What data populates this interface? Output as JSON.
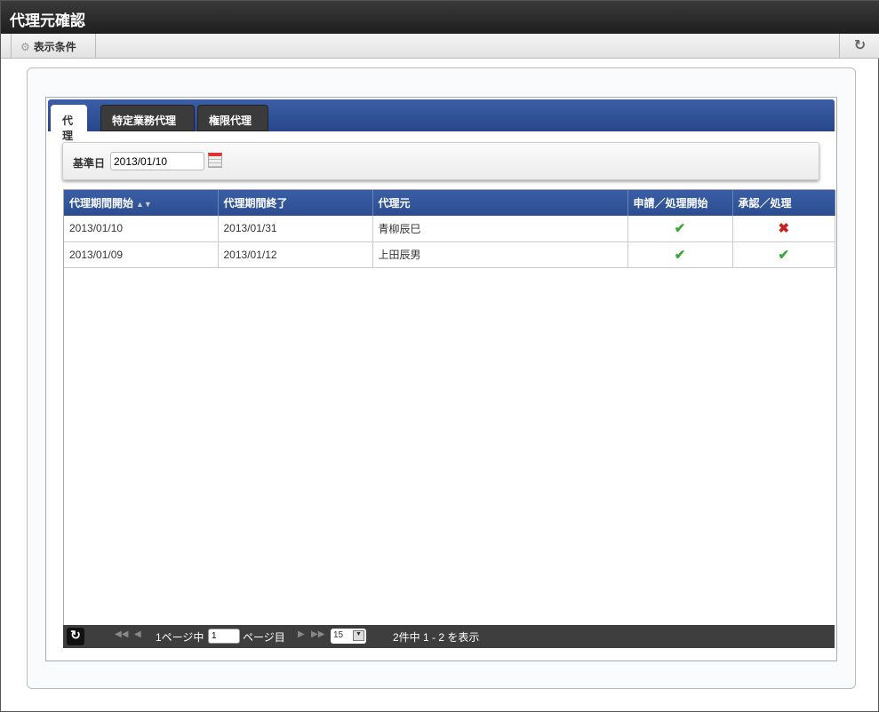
{
  "title": "代理元確認",
  "toolbar": {
    "conditions_label": "表示条件"
  },
  "tabs": [
    {
      "label": "代理"
    },
    {
      "label": "特定業務代理"
    },
    {
      "label": "権限代理"
    }
  ],
  "condition": {
    "label": "基準日",
    "date": "2013/01/10"
  },
  "table": {
    "headers": [
      "代理期間開始",
      "代理期間終了",
      "代理元",
      "申請／処理開始",
      "承認／処理"
    ],
    "rows": [
      {
        "start": "2013/01/10",
        "end": "2013/01/31",
        "source": "青柳辰巳",
        "apply": "✔",
        "approve": "✖"
      },
      {
        "start": "2013/01/09",
        "end": "2013/01/12",
        "source": "上田辰男",
        "apply": "✔",
        "approve": "✔"
      }
    ]
  },
  "pager": {
    "total_pages_text": "1ページ中",
    "page": "1",
    "page_suffix": "ページ目",
    "page_size": "15",
    "summary": "2件中 1 - 2 を表示"
  }
}
